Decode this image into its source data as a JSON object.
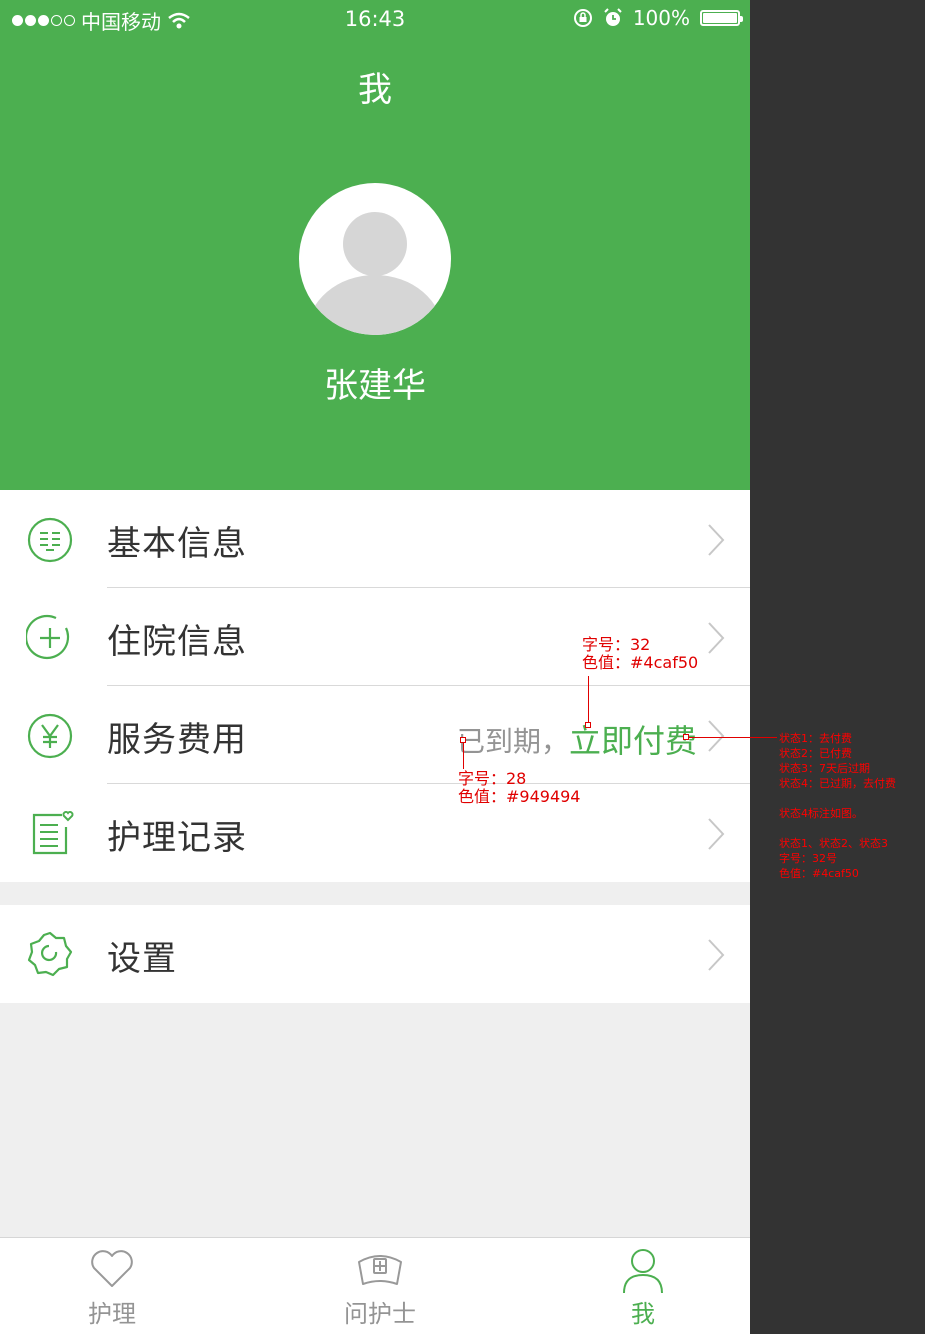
{
  "status_bar": {
    "carrier": "中国移动",
    "time": "16:43",
    "battery": "100%"
  },
  "header": {
    "title": "我",
    "username": "张建华"
  },
  "menu": {
    "items": [
      {
        "label": "基本信息",
        "icon": "document-list-icon"
      },
      {
        "label": "住院信息",
        "icon": "hospital-plus-icon"
      },
      {
        "label": "服务费用",
        "icon": "yen-icon",
        "status_text": "已到期，",
        "action_text": "立即付费"
      },
      {
        "label": "护理记录",
        "icon": "record-heart-icon"
      }
    ],
    "settings": {
      "label": "设置",
      "icon": "gear-icon"
    }
  },
  "tabbar": {
    "tabs": [
      {
        "label": "护理",
        "icon": "heart-icon"
      },
      {
        "label": "问护士",
        "icon": "nurse-cap-icon"
      },
      {
        "label": "我",
        "icon": "person-icon",
        "active": true
      }
    ]
  },
  "annotations": {
    "pay_font": "字号：32",
    "pay_color": "色值：#4caf50",
    "expired_font": "字号：28",
    "expired_color": "色值：#949494",
    "states": [
      "状态1：去付费",
      "状态2：已付费",
      "状态3：7天后过期",
      "状态4：已过期，去付费",
      "",
      "状态4标注如图。",
      "",
      "状态1、状态2、状态3",
      "字号：32号",
      "色值：#4caf50"
    ]
  },
  "colors": {
    "primary": "#4caf50",
    "secondary_text": "#949494",
    "background": "#efefef",
    "annotation_panel": "#333333"
  }
}
